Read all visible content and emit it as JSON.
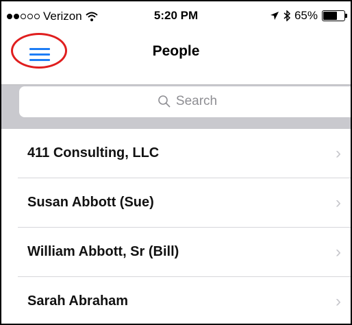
{
  "status_bar": {
    "carrier": "Verizon",
    "time": "5:20 PM",
    "battery": "65%",
    "battery_level": 0.65,
    "icons": [
      "signal-dots-icon",
      "wifi-icon",
      "location-arrow-icon",
      "bluetooth-icon",
      "battery-icon"
    ]
  },
  "navbar": {
    "title": "People",
    "menu_icon": "hamburger-menu-icon",
    "accent_color": "#1e7df5",
    "highlight_color": "#e01e1e"
  },
  "search": {
    "placeholder": "Search",
    "icon": "search-icon"
  },
  "people": [
    {
      "name": "411 Consulting, LLC"
    },
    {
      "name": "Susan Abbott (Sue)"
    },
    {
      "name": "William Abbott, Sr (Bill)"
    },
    {
      "name": "Sarah Abraham"
    }
  ]
}
